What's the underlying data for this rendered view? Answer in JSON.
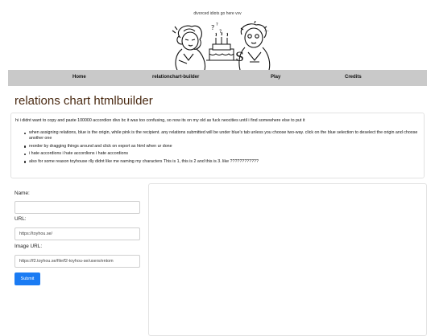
{
  "header": {
    "tagline": "divorced idiots go here vvv"
  },
  "nav": {
    "items": [
      {
        "label": "Home"
      },
      {
        "label": "relationchart-builder"
      },
      {
        "label": "Play"
      },
      {
        "label": "Credits"
      }
    ]
  },
  "page": {
    "title": "relations chart htmlbuilder"
  },
  "info": {
    "intro": "hi i didnt want to copy and paste 100000 accordion divs bc it was too confusing, so now its on my old as fuck neocities until i find somewhere else to put it",
    "bullets": [
      "when assigning relations, blue is the origin, while pink is the recipient. any relations submitted will be under blue's tab unless you choose two-way. click on the blue selection to deselect the origin and choose another one",
      "reorder by dragging things around and click on export as html when ur done",
      "i hate accordions i hate accordions i hate accordions",
      "also for some reason toyhouse rlly didnt like me naming my characters This is 1, this is 2 and this is 3. like ????????????"
    ]
  },
  "form": {
    "name_label": "Name:",
    "name_value": "",
    "url_label": "URL:",
    "url_value": "https://toyhou.se/",
    "image_label": "Image URL:",
    "image_value": "https://f2.toyhou.se/file/f2-toyhou-se/users/entom",
    "submit_label": "Submit"
  },
  "colors": {
    "nav_bg": "#c9c9c9",
    "title": "#4a2a12",
    "submit_bg": "#1a7bf3"
  }
}
